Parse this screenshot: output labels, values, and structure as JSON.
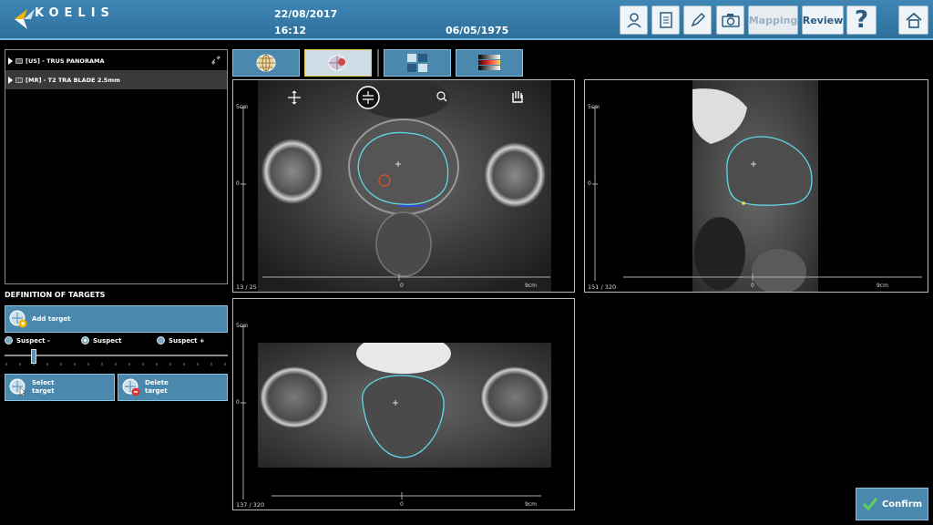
{
  "header": {
    "brand": "KOELIS",
    "date": "22/08/2017",
    "time": "16:12",
    "birth_date": "06/05/1975",
    "buttons": {
      "mapping": "Mapping",
      "review": "Review",
      "help": "?"
    },
    "icons": [
      "patient-icon",
      "report-icon",
      "edit-icon",
      "camera-icon",
      "home-icon"
    ]
  },
  "series": [
    {
      "label": "[US] - TRUS PANORAMA",
      "selected": false
    },
    {
      "label": "[MR] - T2 TRA BLADE 2.5mm",
      "selected": true
    }
  ],
  "targets": {
    "title": "DEFINITION OF TARGETS",
    "add_label": "Add target",
    "radios": [
      {
        "label": "Suspect -",
        "checked": false
      },
      {
        "label": "Suspect",
        "checked": true
      },
      {
        "label": "Suspect +",
        "checked": false
      }
    ],
    "select_label_1": "Select",
    "select_label_2": "target",
    "delete_label_1": "Delete",
    "delete_label_2": "target"
  },
  "views": {
    "axial": {
      "counter": "13 / 25",
      "scale_v": "5cm",
      "scale_zero_v": "0",
      "scale_zero_h": "0",
      "scale_h": "9cm"
    },
    "sagittal": {
      "counter": "151 / 320",
      "scale_v": "5cm",
      "scale_zero_v": "0",
      "scale_zero_h": "0",
      "scale_h": "9cm"
    },
    "coronal": {
      "counter": "137 / 320",
      "scale_v": "5cm",
      "scale_zero_v": "0",
      "scale_zero_h": "0",
      "scale_h": "9cm"
    }
  },
  "confirm_label": "Confirm",
  "colors": {
    "accent": "#4b88ad",
    "header": "#3a80ae",
    "contour": "#5fd8e6"
  }
}
